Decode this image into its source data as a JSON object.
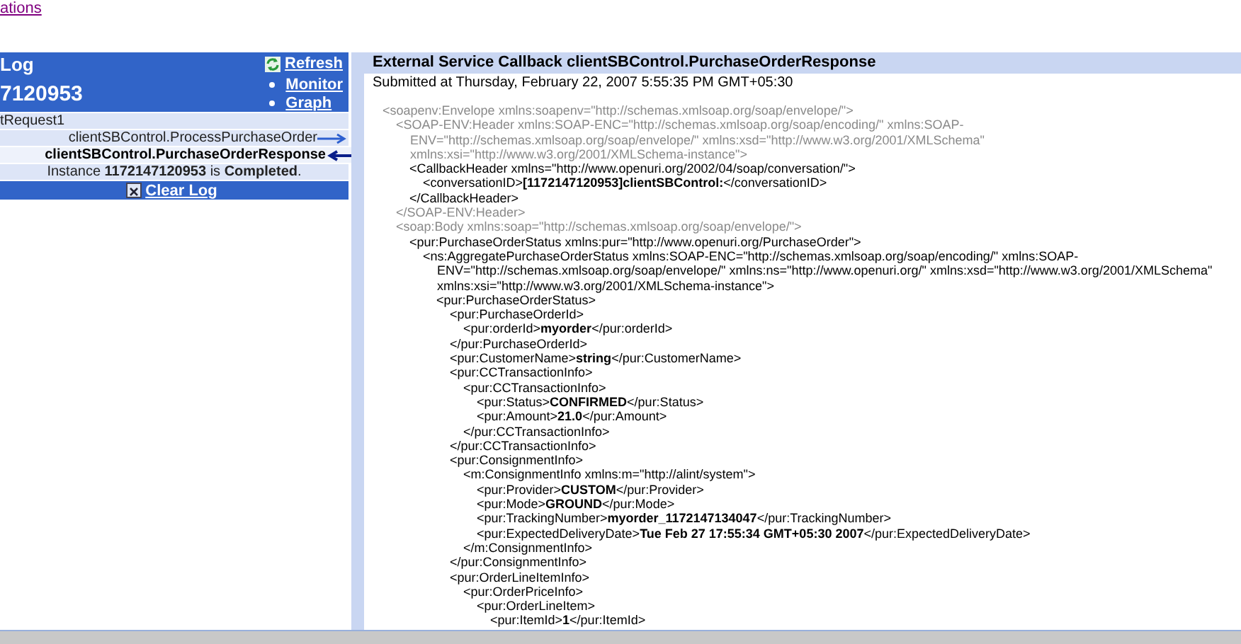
{
  "top_link": "ations",
  "log_panel": {
    "title": "Log",
    "refresh": "Refresh",
    "instance_id": "7120953",
    "links": [
      "Monitor",
      "Graph"
    ],
    "entries": [
      {
        "kind": "plain",
        "text": "tRequest1",
        "selected": false
      },
      {
        "kind": "outgoing",
        "text": "clientSBControl.ProcessPurchaseOrder",
        "selected": false
      },
      {
        "kind": "incoming",
        "text": "clientSBControl.PurchaseOrderResponse",
        "selected": true
      },
      {
        "kind": "status",
        "text": "Instance **1172147120953** is **Completed**.",
        "selected": false
      }
    ],
    "clear_log": "Clear Log"
  },
  "detail": {
    "title": "External Service Callback clientSBControl.PurchaseOrderResponse",
    "submitted": "Submitted at Thursday, February 22, 2007 5:55:35 PM GMT+05:30",
    "xml": [
      {
        "open": "<soapenv:Envelope xmlns:soapenv=\"http://schemas.xmlsoap.org/soap/envelope/\">",
        "muted": true,
        "children": [
          {
            "open": "<SOAP-ENV:Header xmlns:SOAP-ENC=\"http://schemas.xmlsoap.org/soap/encoding/\" xmlns:SOAP-ENV=\"http://schemas.xmlsoap.org/soap/envelope/\" xmlns:xsd=\"http://www.w3.org/2001/XMLSchema\" xmlns:xsi=\"http://www.w3.org/2001/XMLSchema-instance\">",
            "close": "</SOAP-ENV:Header>",
            "muted": true,
            "children": [
              {
                "open": "<CallbackHeader xmlns=\"http://www.openuri.org/2002/04/soap/conversation/\">",
                "close": "</CallbackHeader>",
                "muted": false,
                "children": [
                  {
                    "open": "<conversationID>**[1172147120953]clientSBControl:**</conversationID>",
                    "muted": false
                  }
                ]
              }
            ]
          },
          {
            "open": "<soap:Body xmlns:soap=\"http://schemas.xmlsoap.org/soap/envelope/\">",
            "muted": true,
            "children": [
              {
                "open": "<pur:PurchaseOrderStatus xmlns:pur=\"http://www.openuri.org/PurchaseOrder\">",
                "muted": false,
                "children": [
                  {
                    "open": "<ns:AggregatePurchaseOrderStatus xmlns:SOAP-ENC=\"http://schemas.xmlsoap.org/soap/encoding/\" xmlns:SOAP-ENV=\"http://schemas.xmlsoap.org/soap/envelope/\" xmlns:ns=\"http://www.openuri.org/\" xmlns:xsd=\"http://www.w3.org/2001/XMLSchema\" xmlns:xsi=\"http://www.w3.org/2001/XMLSchema-instance\">",
                    "muted": false,
                    "children": [
                      {
                        "open": "<pur:PurchaseOrderStatus>",
                        "muted": false,
                        "children": [
                          {
                            "open": "<pur:PurchaseOrderId>",
                            "close": "</pur:PurchaseOrderId>",
                            "muted": false,
                            "children": [
                              {
                                "open": "<pur:orderId>**myorder**</pur:orderId>",
                                "muted": false
                              }
                            ]
                          },
                          {
                            "open": "<pur:CustomerName>**string**</pur:CustomerName>",
                            "muted": false
                          },
                          {
                            "open": "<pur:CCTransactionInfo>",
                            "close": "</pur:CCTransactionInfo>",
                            "muted": false,
                            "children": [
                              {
                                "open": "<pur:CCTransactionInfo>",
                                "close": "</pur:CCTransactionInfo>",
                                "muted": false,
                                "children": [
                                  {
                                    "open": "<pur:Status>**CONFIRMED**</pur:Status>",
                                    "muted": false
                                  },
                                  {
                                    "open": "<pur:Amount>**21.0**</pur:Amount>",
                                    "muted": false
                                  }
                                ]
                              }
                            ]
                          },
                          {
                            "open": "<pur:ConsignmentInfo>",
                            "close": "</pur:ConsignmentInfo>",
                            "muted": false,
                            "children": [
                              {
                                "open": "<m:ConsignmentInfo xmlns:m=\"http://alint/system\">",
                                "close": "</m:ConsignmentInfo>",
                                "muted": false,
                                "children": [
                                  {
                                    "open": "<pur:Provider>**CUSTOM**</pur:Provider>",
                                    "muted": false
                                  },
                                  {
                                    "open": "<pur:Mode>**GROUND**</pur:Mode>",
                                    "muted": false
                                  },
                                  {
                                    "open": "<pur:TrackingNumber>**myorder_1172147134047**</pur:TrackingNumber>",
                                    "muted": false
                                  },
                                  {
                                    "open": "<pur:ExpectedDeliveryDate>**Tue Feb 27 17:55:34 GMT+05:30 2007**</pur:ExpectedDeliveryDate>",
                                    "muted": false
                                  }
                                ]
                              }
                            ]
                          },
                          {
                            "open": "<pur:OrderLineItemInfo>",
                            "muted": false,
                            "children": [
                              {
                                "open": "<pur:OrderPriceInfo>",
                                "muted": false,
                                "children": [
                                  {
                                    "open": "<pur:OrderLineItem>",
                                    "muted": false,
                                    "children": [
                                      {
                                        "open": "<pur:ItemId>**1**</pur:ItemId>",
                                        "muted": false
                                      }
                                    ]
                                  }
                                ]
                              }
                            ]
                          }
                        ]
                      }
                    ]
                  }
                ]
              }
            ]
          }
        ]
      }
    ]
  }
}
